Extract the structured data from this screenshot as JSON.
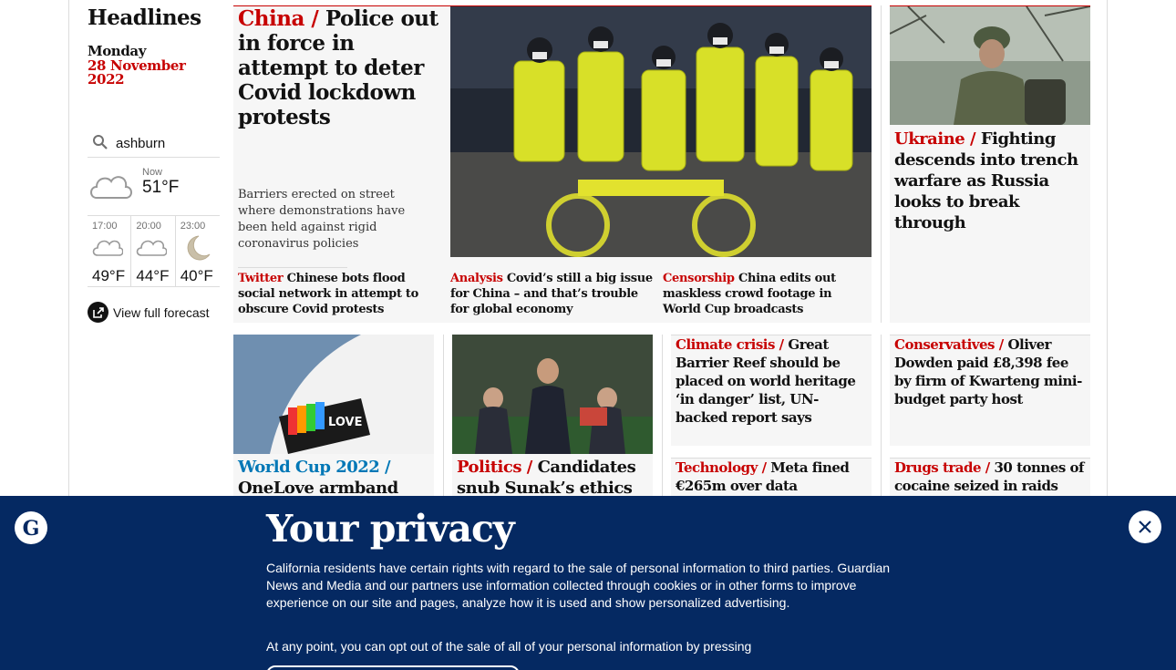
{
  "sidebar": {
    "title": "Headlines",
    "day": "Monday",
    "date": "28 November 2022",
    "location": "ashburn",
    "now_label": "Now",
    "now_temp": "51°F",
    "forecast": [
      {
        "time": "17:00",
        "temp": "49°F",
        "icon": "partly-cloudy-icon"
      },
      {
        "time": "20:00",
        "temp": "44°F",
        "icon": "cloudy-night-icon"
      },
      {
        "time": "23:00",
        "temp": "40°F",
        "icon": "moon-icon"
      }
    ],
    "view_forecast": "View full forecast"
  },
  "lead": {
    "kicker": "China /",
    "headline": "Police out in force in attempt to deter Covid lockdown protests",
    "standfirst": "Barriers erected on street where demonstrations have been held against rigid coronavirus policies",
    "sublinks": [
      {
        "kicker": "Twitter",
        "text": "Chinese bots flood social network in attempt to obscure Covid protests"
      },
      {
        "kicker": "Analysis",
        "text": "Covid’s still a big issue for China – and that’s trouble for global economy"
      },
      {
        "kicker": "Censorship",
        "text": "China edits out maskless crowd footage in World Cup broadcasts"
      }
    ]
  },
  "ukraine": {
    "kicker": "Ukraine /",
    "headline": "Fighting descends into trench warfare as Russia looks to break through"
  },
  "worldcup": {
    "kicker": "World Cup 2022 /",
    "headline": "OneLove armband"
  },
  "politics": {
    "kicker": "Politics /",
    "headline": "Candidates snub Sunak’s ethics"
  },
  "climate": {
    "kicker": "Climate crisis /",
    "headline": "Great Barrier Reef should be placed on world heritage ‘in danger’ list, UN-backed report says"
  },
  "conservatives": {
    "kicker": "Conservatives /",
    "headline": "Oliver Dowden paid £8,398 fee by firm of Kwarteng mini-budget party host"
  },
  "technology": {
    "kicker": "Technology /",
    "headline": "Meta fined €265m over data"
  },
  "drugs": {
    "kicker": "Drugs trade /",
    "headline": "30 tonnes of cocaine seized in raids"
  },
  "privacy": {
    "title": "Your privacy",
    "para1": "California residents have certain rights with regard to the sale of personal information to third parties. Guardian News and Media and our partners use information collected through cookies or in other forms to improve experience on our site and pages, analyze how it is used and show personalized advertising.",
    "para2": "At any point, you can opt out of the sale of all of your personal information by pressing"
  },
  "colors": {
    "news_red": "#c70000",
    "sport_blue": "#0077b6",
    "guardian_navy": "#052962"
  }
}
